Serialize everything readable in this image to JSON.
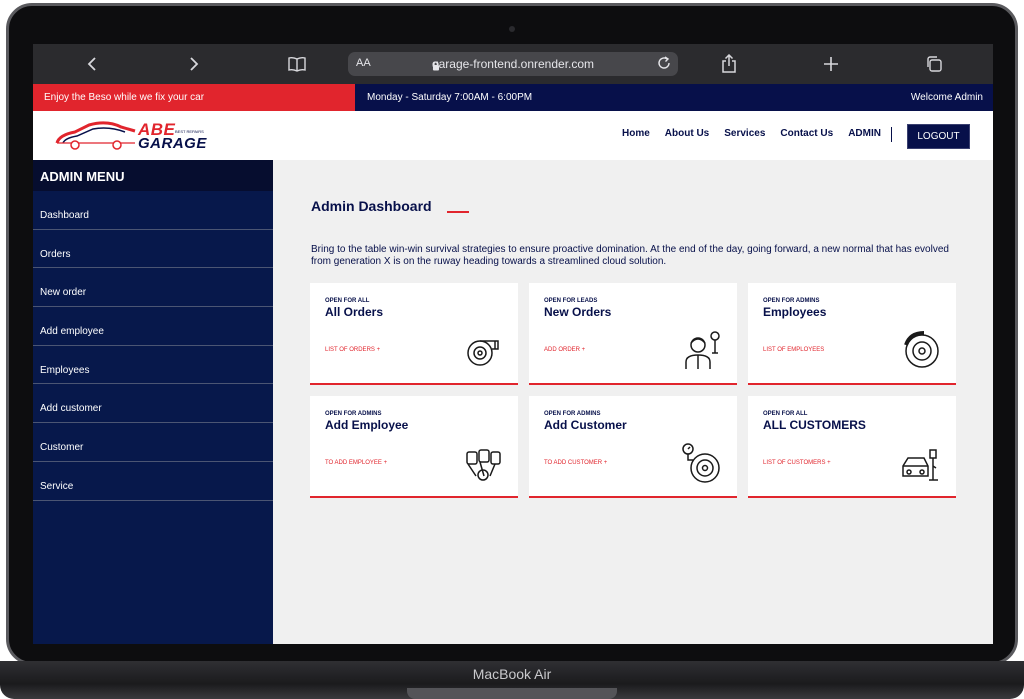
{
  "device": {
    "label": "MacBook Air"
  },
  "browser": {
    "aa": "AA",
    "url": "garage-frontend.onrender.com",
    "icons": [
      "back-icon",
      "forward-icon",
      "bookmarks-icon",
      "lock-icon",
      "reload-icon",
      "share-icon",
      "new-tab-icon",
      "tabs-icon"
    ]
  },
  "topbar": {
    "promo": "Enjoy the Beso while we fix your car",
    "hours": "Monday - Saturday 7:00AM - 6:00PM",
    "welcome": "Welcome Admin"
  },
  "header": {
    "logo_abe": "ABE",
    "logo_garage": "GARAGE",
    "logo_tag": "BEST REPAIRS",
    "nav": [
      "Home",
      "About Us",
      "Services",
      "Contact Us",
      "ADMIN"
    ],
    "logout": "LOGOUT"
  },
  "sidebar": {
    "title": "ADMIN MENU",
    "items": [
      "Dashboard",
      "Orders",
      "New order",
      "Add employee",
      "Employees",
      "Add customer",
      "Customer",
      "Service"
    ]
  },
  "main": {
    "title": "Admin Dashboard",
    "intro": "Bring to the table win-win survival strategies to ensure proactive domination. At the end of the day, going forward, a new normal that has evolved from generation X is on the ruway heading towards a streamlined cloud solution.",
    "cards": [
      {
        "kicker": "OPEN FOR ALL",
        "title": "All Orders",
        "link": "LIST OF ORDERS +",
        "icon": "turbo-icon"
      },
      {
        "kicker": "OPEN FOR LEADS",
        "title": "New Orders",
        "link": "ADD ORDER +",
        "icon": "mechanic-icon"
      },
      {
        "kicker": "OPEN FOR ADMINS",
        "title": "Employees",
        "link": "LIST OF EMPLOYEES",
        "icon": "brake-disc-icon"
      },
      {
        "kicker": "OPEN FOR ADMINS",
        "title": "Add Employee",
        "link": "TO ADD EMPLOYEE +",
        "icon": "engine-icon"
      },
      {
        "kicker": "OPEN FOR ADMINS",
        "title": "Add Customer",
        "link": "TO ADD CUSTOMER +",
        "icon": "tire-gauge-icon"
      },
      {
        "kicker": "OPEN FOR ALL",
        "title": "ALL CUSTOMERS",
        "link": "LIST OF CUSTOMERS +",
        "icon": "car-paint-icon"
      }
    ]
  },
  "colors": {
    "navy": "#07104a",
    "sidebar": "#07184b",
    "red": "#e1252d",
    "content_bg": "#f0f0f0"
  }
}
